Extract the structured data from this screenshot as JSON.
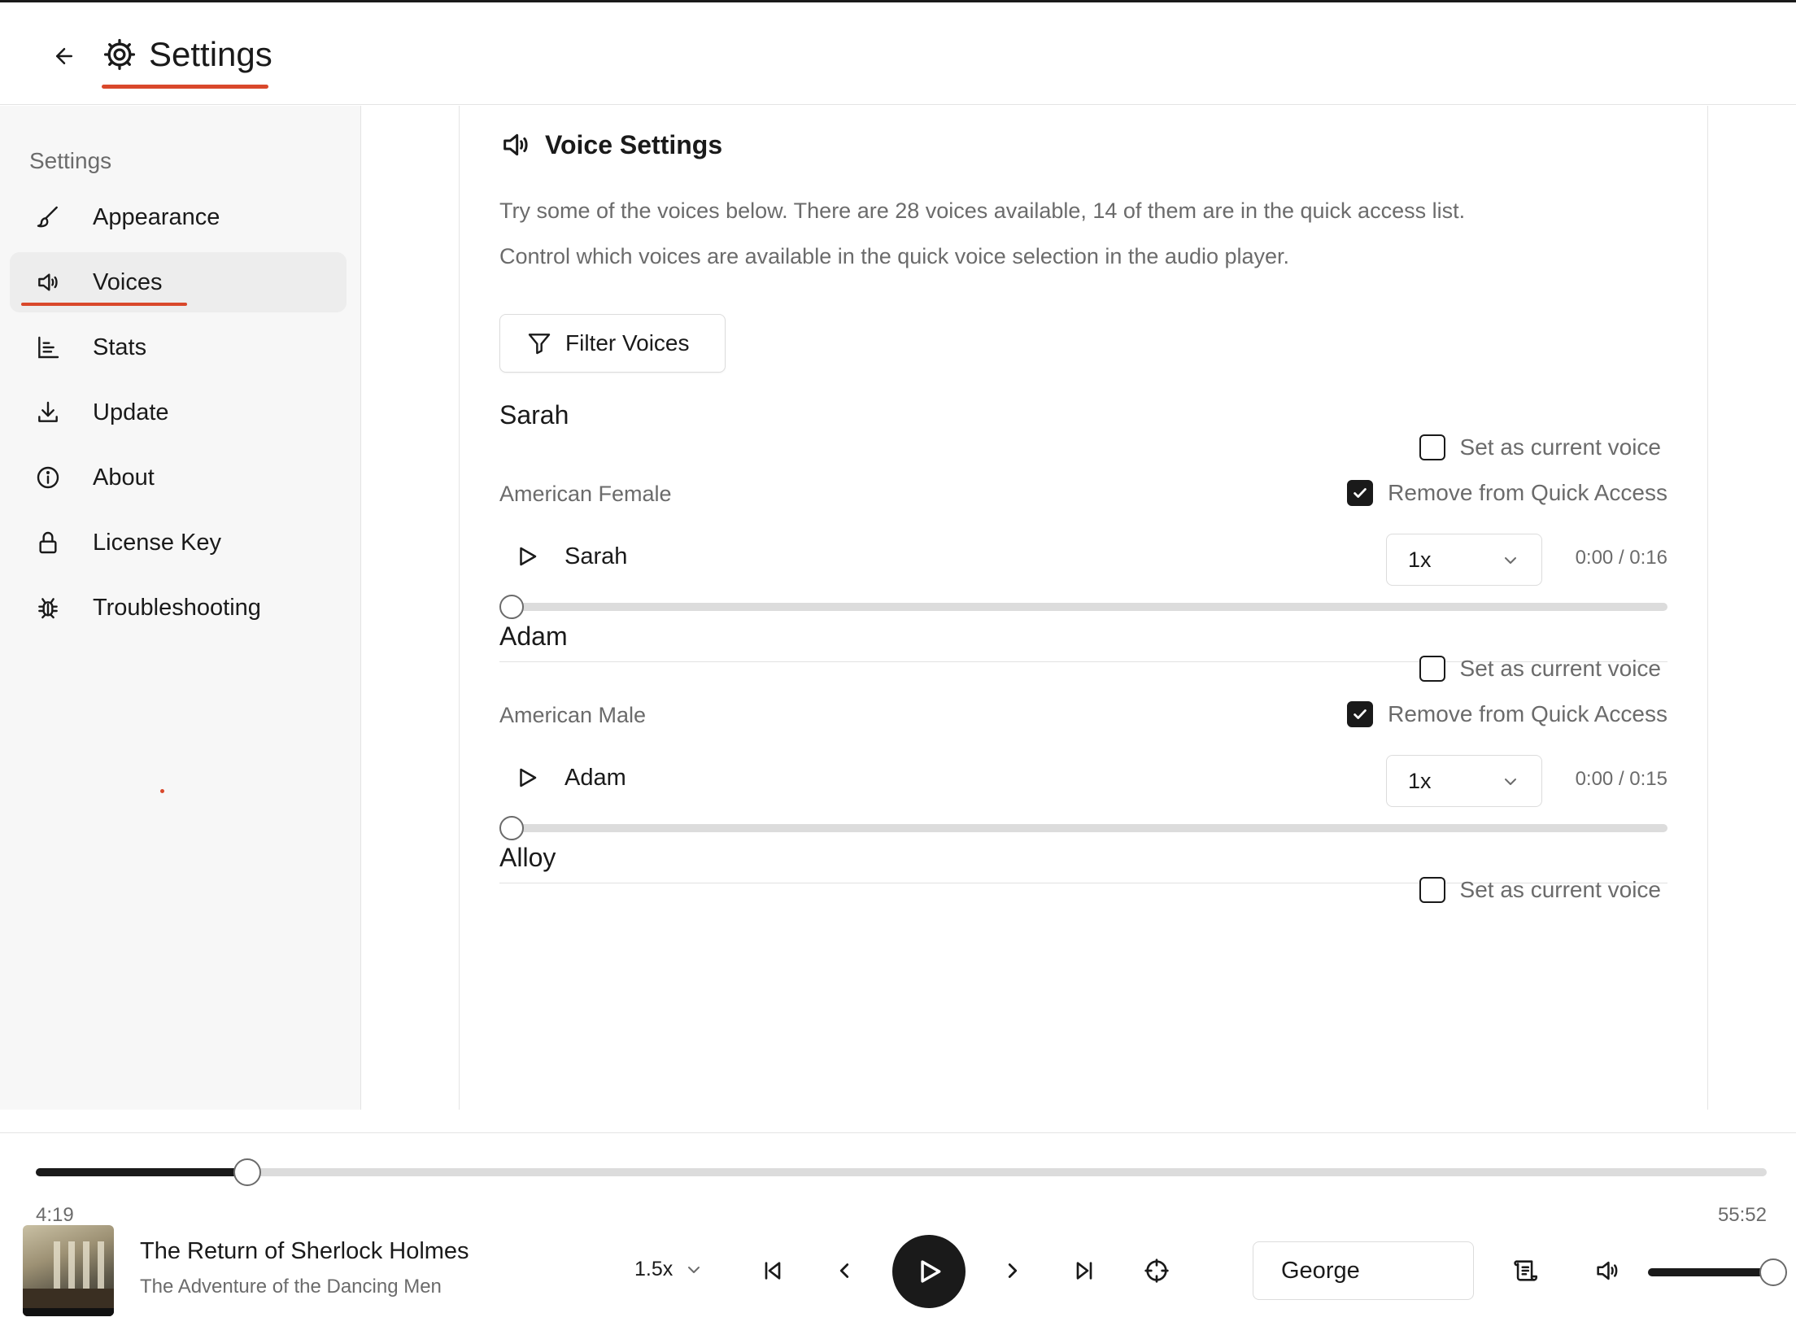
{
  "header": {
    "title": "Settings",
    "back_icon": "arrow-left-icon",
    "title_icon": "gear-icon"
  },
  "sidebar": {
    "title": "Settings",
    "items": [
      {
        "label": "Appearance",
        "icon": "paintbrush-icon",
        "active": false
      },
      {
        "label": "Voices",
        "icon": "speaker-icon",
        "active": true
      },
      {
        "label": "Stats",
        "icon": "chart-icon",
        "active": false
      },
      {
        "label": "Update",
        "icon": "download-icon",
        "active": false
      },
      {
        "label": "About",
        "icon": "info-icon",
        "active": false
      },
      {
        "label": "License Key",
        "icon": "lock-icon",
        "active": false
      },
      {
        "label": "Troubleshooting",
        "icon": "bug-icon",
        "active": false
      }
    ]
  },
  "voice_settings": {
    "title": "Voice Settings",
    "description_1": "Try some of the voices below. There are 28 voices available, 14 of them are in the quick access list.",
    "description_2": "Control which voices are available in the quick voice selection in the audio player.",
    "filter_label": "Filter Voices",
    "voices": [
      {
        "name": "Sarah",
        "description": "American Female",
        "set_current_label": "Set as current voice",
        "set_current_checked": false,
        "quick_access_label": "Remove from Quick Access",
        "quick_access_checked": true,
        "player_label": "Sarah",
        "speed": "1x",
        "time": "0:00 / 0:16",
        "progress": 0
      },
      {
        "name": "Adam",
        "description": "American Male",
        "set_current_label": "Set as current voice",
        "set_current_checked": false,
        "quick_access_label": "Remove from Quick Access",
        "quick_access_checked": true,
        "player_label": "Adam",
        "speed": "1x",
        "time": "0:00 / 0:15",
        "progress": 0
      },
      {
        "name": "Alloy",
        "set_current_label": "Set as current voice",
        "set_current_checked": false
      }
    ]
  },
  "player": {
    "elapsed": "4:19",
    "total": "55:52",
    "progress": 0.0773,
    "book_title": "The Return of Sherlock Holmes",
    "chapter": "The Adventure of the Dancing Men",
    "rate": "1.5x",
    "voice": "George",
    "volume": 1.0
  },
  "colors": {
    "accent": "#d9482b",
    "text": "#1a1a1a",
    "muted": "#6b6b6b",
    "border": "#e4e4e4"
  }
}
